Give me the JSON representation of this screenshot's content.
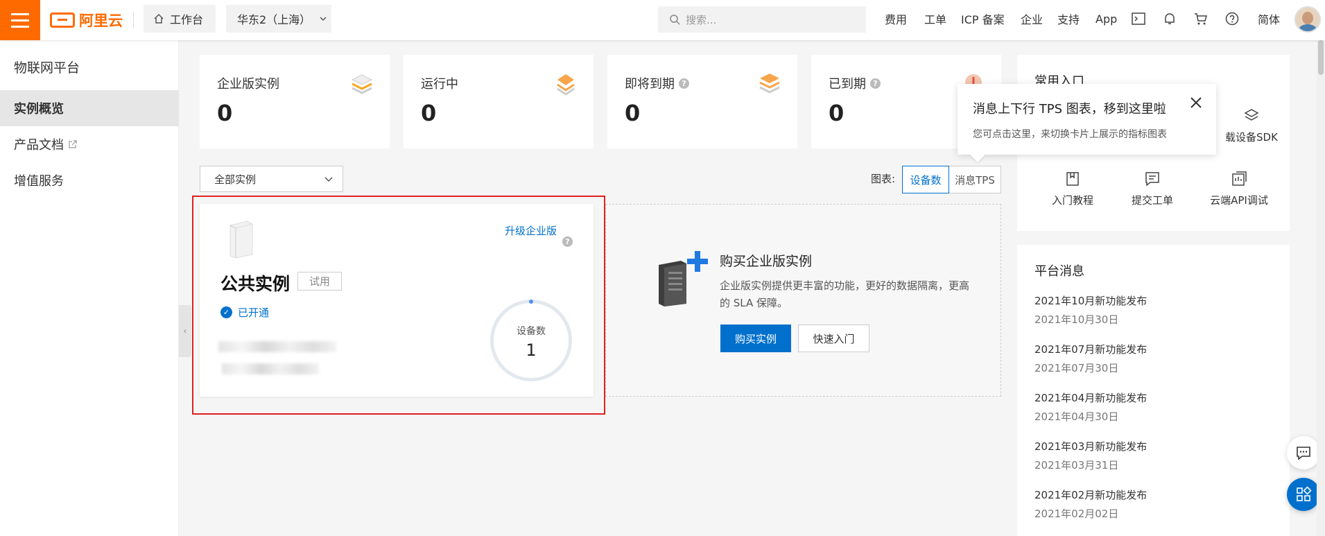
{
  "header": {
    "logo_text": "阿里云",
    "workbench": "工作台",
    "region": "华东2（上海）",
    "search_placeholder": "搜索...",
    "nav": [
      "费用",
      "工单",
      "ICP 备案",
      "企业",
      "支持",
      "App"
    ],
    "lang": "简体"
  },
  "sidebar": {
    "title": "物联网平台",
    "items": [
      {
        "label": "实例概览"
      },
      {
        "label": "产品文档"
      },
      {
        "label": "增值服务"
      }
    ]
  },
  "stats": [
    {
      "label": "企业版实例",
      "value": "0"
    },
    {
      "label": "运行中",
      "value": "0"
    },
    {
      "label": "即将到期",
      "value": "0"
    },
    {
      "label": "已到期",
      "value": "0"
    }
  ],
  "filter": {
    "select_value": "全部实例",
    "chart_label": "图表:",
    "seg_devices": "设备数",
    "seg_tps": "消息TPS"
  },
  "instance": {
    "title": "公共实例",
    "badge": "试用",
    "status": "已开通",
    "upgrade": "升级企业版",
    "ring_label": "设备数",
    "ring_value": "1"
  },
  "promo": {
    "title": "购买企业版实例",
    "desc": "企业版实例提供更丰富的功能，更好的数据隔离，更高的 SLA 保障。",
    "buy": "购买实例",
    "quickstart": "快速入门"
  },
  "shortcuts": {
    "title": "常用入口",
    "sdk": "载设备SDK",
    "tutorial": "入门教程",
    "ticket": "提交工单",
    "api": "云端API调试"
  },
  "news": {
    "title": "平台消息",
    "items": [
      {
        "title": "2021年10月新功能发布",
        "date": "2021年10月30日"
      },
      {
        "title": "2021年07月新功能发布",
        "date": "2021年07月30日"
      },
      {
        "title": "2021年04月新功能发布",
        "date": "2021年04月30日"
      },
      {
        "title": "2021年03月新功能发布",
        "date": "2021年03月31日"
      },
      {
        "title": "2021年02月新功能发布",
        "date": "2021年02月02日"
      }
    ]
  },
  "tooltip": {
    "title": "消息上下行 TPS 图表，移到这里啦",
    "desc": "您可点击这里，来切换卡片上展示的指标图表"
  },
  "colors": {
    "brand": "#ff6a00",
    "primary": "#0070cc",
    "highlight": "#e02020"
  }
}
